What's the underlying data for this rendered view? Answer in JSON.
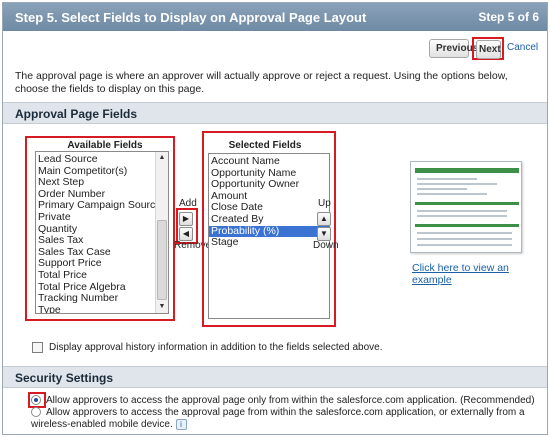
{
  "header": {
    "title": "Step 5. Select Fields to Display on Approval Page Layout",
    "step": "Step 5 of 6"
  },
  "toolbar": {
    "previous_label": "Previous",
    "next_label": "Next",
    "cancel_label": "Cancel"
  },
  "description": "The approval page is where an approver will actually approve or reject a request. Using the options below, choose the fields to display on this page.",
  "approval_fields": {
    "section_title": "Approval Page Fields",
    "available_title": "Available Fields",
    "available": [
      "Lead Source",
      "Main Competitor(s)",
      "Next Step",
      "Order Number",
      "Primary Campaign Source",
      "Private",
      "Quantity",
      "Sales Tax",
      "Sales Tax Case",
      "Support Price",
      "Total Price",
      "Total Price Algebra",
      "Tracking Number",
      "Type"
    ],
    "selected_title": "Selected Fields",
    "selected": [
      "Account Name",
      "Opportunity Name",
      "Opportunity Owner",
      "Amount",
      "Close Date",
      "Created By",
      "Probability (%)",
      "Stage"
    ],
    "selected_highlight": "Probability (%)",
    "add_label": "Add",
    "remove_label": "Remove",
    "up_label": "Up",
    "down_label": "Down",
    "example_link": "Click here to view an example",
    "history_label": "Display approval history information in addition to the fields selected above."
  },
  "security": {
    "section_title": "Security Settings",
    "option1": "Allow approvers to access the approval page only from within the salesforce.com application. (Recommended)",
    "option2": "Allow approvers to access the approval page from within the salesforce.com application, or externally from a wireless-enabled mobile device.",
    "selected_option": 1
  },
  "colors": {
    "accent_red": "#d71b22",
    "header_blue": "#7891aa",
    "link": "#1a5fa8",
    "selection": "#3a73d1"
  }
}
